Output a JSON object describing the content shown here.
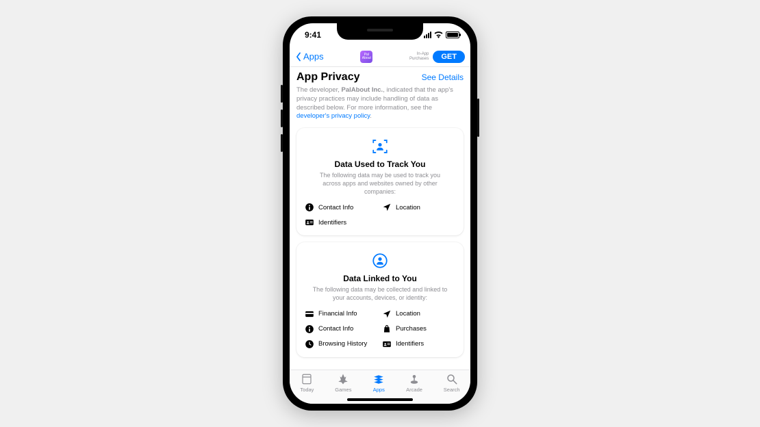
{
  "status": {
    "time": "9:41"
  },
  "nav": {
    "back_label": "Apps",
    "app_icon_text": "Pal About",
    "iap_line1": "In-App",
    "iap_line2": "Purchases",
    "get_label": "GET"
  },
  "header": {
    "title": "App Privacy",
    "see_details": "See Details"
  },
  "intro": {
    "prefix": "The developer, ",
    "developer": "PalAbout Inc.",
    "middle": ", indicated that the app's privacy practices may include handling of data as described below. For more information, see the ",
    "link_text": "developer's privacy policy",
    "suffix": "."
  },
  "cards": {
    "track": {
      "title": "Data Used to Track You",
      "desc": "The following data may be used to track you across apps and websites owned by other companies:",
      "items": [
        {
          "label": "Contact Info",
          "icon": "info"
        },
        {
          "label": "Location",
          "icon": "location"
        },
        {
          "label": "Identifiers",
          "icon": "identifiers"
        }
      ]
    },
    "linked": {
      "title": "Data Linked to You",
      "desc": "The following data may be collected and linked to your accounts, devices, or identity:",
      "items": [
        {
          "label": "Financial Info",
          "icon": "financial"
        },
        {
          "label": "Location",
          "icon": "location"
        },
        {
          "label": "Contact Info",
          "icon": "info"
        },
        {
          "label": "Purchases",
          "icon": "purchases"
        },
        {
          "label": "Browsing History",
          "icon": "history"
        },
        {
          "label": "Identifiers",
          "icon": "identifiers"
        }
      ]
    }
  },
  "tabs": {
    "today": "Today",
    "games": "Games",
    "apps": "Apps",
    "arcade": "Arcade",
    "search": "Search"
  }
}
